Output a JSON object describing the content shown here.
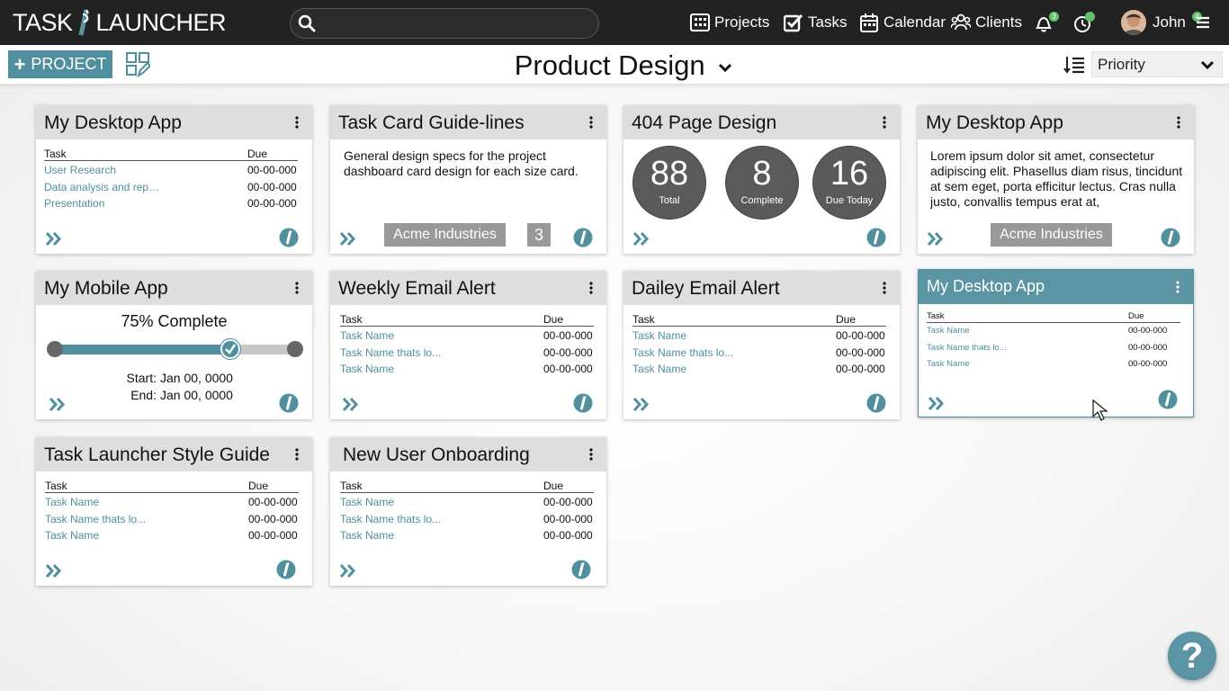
{
  "app": {
    "logo_left": "TASK",
    "logo_right": "LAUNCHER",
    "brand_color": "#4f8f9e"
  },
  "search": {
    "placeholder": "",
    "value": ""
  },
  "nav": {
    "projects": "Projects",
    "tasks": "Tasks",
    "calendar": "Calendar",
    "clients": "Clients",
    "notifications_count": "3",
    "user_name": "John",
    "user_badge": "4"
  },
  "toolbar": {
    "add_project_label": "PROJECT",
    "page_title": "Product Design",
    "sort_label": "Priority"
  },
  "cards": [
    {
      "title": "My Desktop App",
      "tasks_header": "Task",
      "due_header": "Due",
      "rows": [
        {
          "task": "User Research",
          "due": "00-00-000"
        },
        {
          "task": "Data analysis and rep…",
          "due": "00-00-000"
        },
        {
          "task": "Presentation",
          "due": "00-00-000"
        }
      ]
    },
    {
      "title": "Task Card Guide-lines",
      "description": "General design specs for the project dashboard card design for each size card.",
      "client": "Acme Industries",
      "count": "3"
    },
    {
      "title": "404 Page Design",
      "stats": [
        {
          "value": "88",
          "label": "Total"
        },
        {
          "value": "8",
          "label": "Complete"
        },
        {
          "value": "16",
          "label": "Due Today"
        }
      ]
    },
    {
      "title": "My Desktop App",
      "description": "Lorem ipsum dolor sit amet, consectetur adipiscing elit. Phasellus diam risus, tincidunt at sem eget, porta efficitur lectus. Cras nulla justo, convallis tempus erat at,",
      "client": "Acme Industries"
    },
    {
      "title": "My Mobile App",
      "progress_label": "75% Complete",
      "progress": 0.75,
      "start_key": "Start:",
      "start_value": "Jan 00, 0000",
      "end_key": "End:",
      "end_value": "Jan 00, 0000"
    },
    {
      "title": "Weekly Email Alert",
      "tasks_header": "Task",
      "due_header": "Due",
      "rows": [
        {
          "task": "Task Name",
          "due": "00-00-000"
        },
        {
          "task": "Task Name thats lo...",
          "due": "00-00-000"
        },
        {
          "task": "Task Name",
          "due": "00-00-000"
        }
      ]
    },
    {
      "title": "Dailey Email Alert",
      "tasks_header": "Task",
      "due_header": "Due",
      "rows": [
        {
          "task": "Task Name",
          "due": "00-00-000"
        },
        {
          "task": "Task Name thats lo...",
          "due": "00-00-000"
        },
        {
          "task": "Task Name",
          "due": "00-00-000"
        }
      ]
    },
    {
      "title": "My Desktop App",
      "tasks_header": "Task",
      "due_header": "Due",
      "rows": [
        {
          "task": "Task Name",
          "due": "00-00-000"
        },
        {
          "task": "Task Name thats lo...",
          "due": "00-00-000"
        },
        {
          "task": "Task Name",
          "due": "00-00-000"
        }
      ]
    },
    {
      "title": "Task Launcher Style Guide",
      "tasks_header": "Task",
      "due_header": "Due",
      "rows": [
        {
          "task": "Task Name",
          "due": "00-00-000"
        },
        {
          "task": "Task Name thats lo...",
          "due": "00-00-000"
        },
        {
          "task": "Task Name",
          "due": "00-00-000"
        }
      ]
    },
    {
      "title": "New User Onboarding",
      "tasks_header": "Task",
      "due_header": "Due",
      "rows": [
        {
          "task": "Task Name",
          "due": "00-00-000"
        },
        {
          "task": "Task Name thats lo...",
          "due": "00-00-000"
        },
        {
          "task": "Task Name",
          "due": "00-00-000"
        }
      ]
    }
  ],
  "help": {
    "label": "?"
  }
}
